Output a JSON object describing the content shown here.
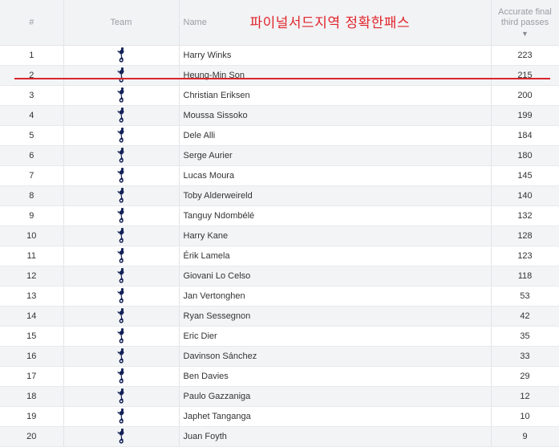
{
  "header": {
    "rank": "#",
    "team": "Team",
    "name": "Name",
    "stat_line1": "Accurate final",
    "stat_line2": "third passes",
    "sort_indicator": "▼"
  },
  "annotation": {
    "text": "파이널서드지역 정확한패스",
    "color": "#e0252b",
    "underline_color": "#d7262c"
  },
  "team_icon": "tottenham-cockerel-icon",
  "rows": [
    {
      "rank": "1",
      "name": "Harry Winks",
      "value": "223"
    },
    {
      "rank": "2",
      "name": "Heung-Min Son",
      "value": "215"
    },
    {
      "rank": "3",
      "name": "Christian Eriksen",
      "value": "200"
    },
    {
      "rank": "4",
      "name": "Moussa Sissoko",
      "value": "199"
    },
    {
      "rank": "5",
      "name": "Dele Alli",
      "value": "184"
    },
    {
      "rank": "6",
      "name": "Serge Aurier",
      "value": "180"
    },
    {
      "rank": "7",
      "name": "Lucas Moura",
      "value": "145"
    },
    {
      "rank": "8",
      "name": "Toby Alderweireld",
      "value": "140"
    },
    {
      "rank": "9",
      "name": "Tanguy Ndombélé",
      "value": "132"
    },
    {
      "rank": "10",
      "name": "Harry Kane",
      "value": "128"
    },
    {
      "rank": "11",
      "name": "Érik Lamela",
      "value": "123"
    },
    {
      "rank": "12",
      "name": "Giovani Lo Celso",
      "value": "118"
    },
    {
      "rank": "13",
      "name": "Jan Vertonghen",
      "value": "53"
    },
    {
      "rank": "14",
      "name": "Ryan Sessegnon",
      "value": "42"
    },
    {
      "rank": "15",
      "name": "Eric Dier",
      "value": "35"
    },
    {
      "rank": "16",
      "name": "Davinson Sánchez",
      "value": "33"
    },
    {
      "rank": "17",
      "name": "Ben Davies",
      "value": "29"
    },
    {
      "rank": "18",
      "name": "Paulo Gazzaniga",
      "value": "12"
    },
    {
      "rank": "19",
      "name": "Japhet Tanganga",
      "value": "10"
    },
    {
      "rank": "20",
      "name": "Juan Foyth",
      "value": "9"
    }
  ]
}
